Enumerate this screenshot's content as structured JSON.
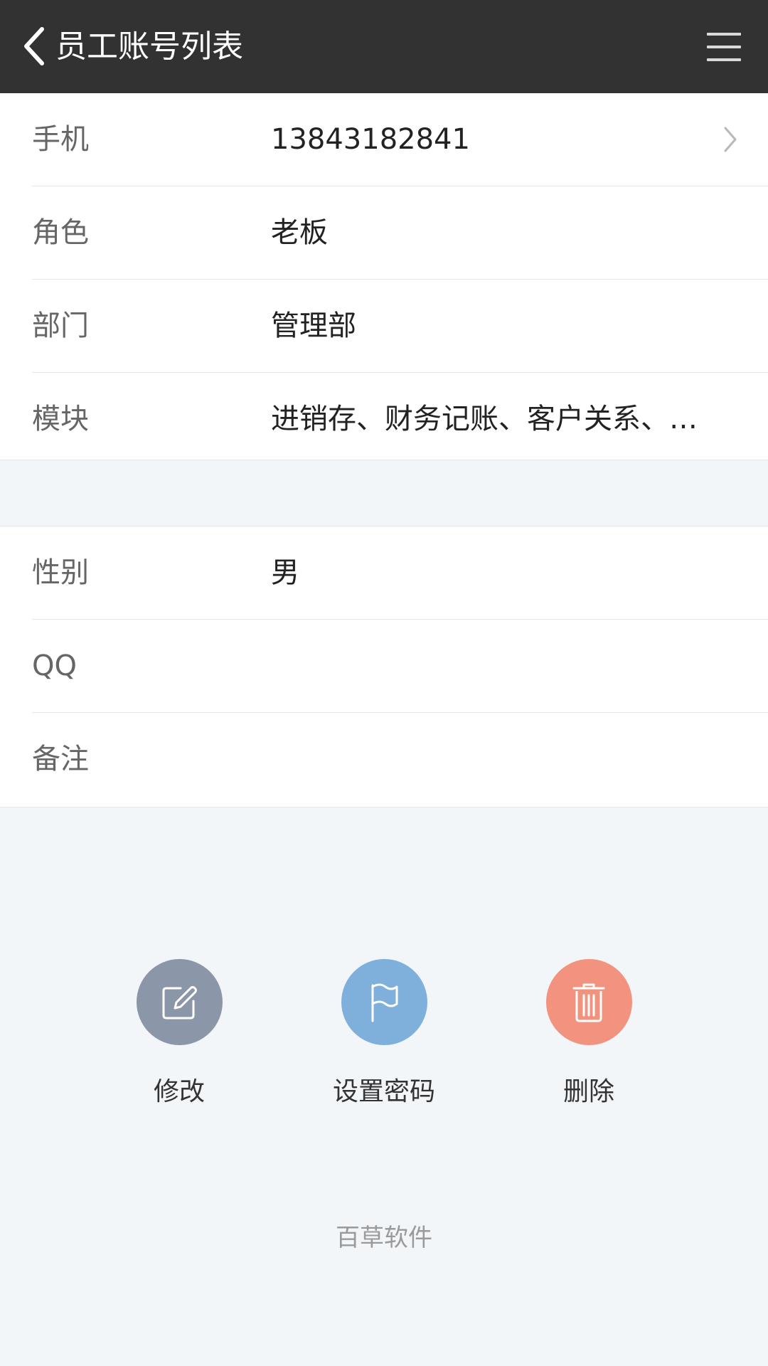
{
  "header": {
    "title": "员工账号列表",
    "back_icon": "chevron-left-icon",
    "menu_icon": "hamburger-menu-icon",
    "background": "#323232"
  },
  "section1": {
    "rows": [
      {
        "label": "手机",
        "value": "13843182841",
        "has_chevron": true
      },
      {
        "label": "角色",
        "value": "老板"
      },
      {
        "label": "部门",
        "value": "管理部"
      },
      {
        "label": "模块",
        "value": "进销存、财务记账、客户关系、仓..."
      }
    ]
  },
  "section2": {
    "rows": [
      {
        "label": "性别",
        "value": "男"
      },
      {
        "label": "QQ",
        "value": ""
      },
      {
        "label": "备注",
        "value": ""
      }
    ]
  },
  "actions": [
    {
      "label": "修改",
      "icon": "edit-icon",
      "color": "#8b96a8"
    },
    {
      "label": "设置密码",
      "icon": "flag-icon",
      "color": "#7fb0dc"
    },
    {
      "label": "删除",
      "icon": "trash-icon",
      "color": "#f2937f"
    }
  ],
  "footer": {
    "text": "百草软件"
  }
}
